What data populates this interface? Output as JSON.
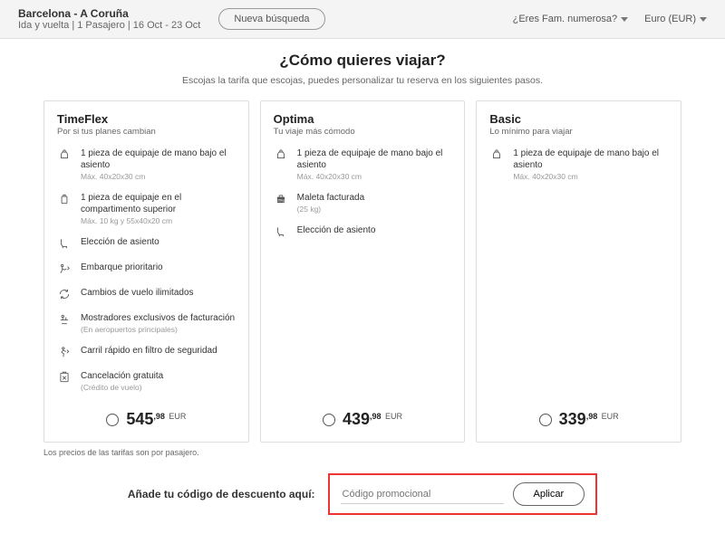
{
  "topbar": {
    "route": "Barcelona - A Coruña",
    "details": "Ida y vuelta | 1 Pasajero | 16 Oct - 23 Oct",
    "new_search": "Nueva búsqueda",
    "fam": "¿Eres Fam. numerosa?",
    "currency": "Euro (EUR)"
  },
  "heading": {
    "title": "¿Cómo quieres viajar?",
    "subtitle": "Escojas la tarifa que escojas, puedes personalizar tu reserva en los siguientes pasos."
  },
  "fares": [
    {
      "name": "TimeFlex",
      "tagline": "Por si tus planes cambian",
      "price_int": "545",
      "price_dec": ",98",
      "currency": "EUR",
      "features": [
        {
          "icon": "bag-under-seat",
          "text": "1 pieza de equipaje de mano bajo el asiento",
          "sub": "Máx. 40x20x30 cm"
        },
        {
          "icon": "cabin-bag",
          "text": "1 pieza de equipaje en el compartimento superior",
          "sub": "Máx. 10 kg y 55x40x20 cm"
        },
        {
          "icon": "seat",
          "text": "Elección de asiento",
          "sub": ""
        },
        {
          "icon": "priority",
          "text": "Embarque prioritario",
          "sub": ""
        },
        {
          "icon": "changes",
          "text": "Cambios de vuelo ilimitados",
          "sub": ""
        },
        {
          "icon": "desk",
          "text": "Mostradores exclusivos de facturación",
          "sub": "(En aeropuertos principales)"
        },
        {
          "icon": "fast-lane",
          "text": "Carril rápido en filtro de seguridad",
          "sub": ""
        },
        {
          "icon": "cancel",
          "text": "Cancelación gratuita",
          "sub": "(Crédito de vuelo)"
        }
      ]
    },
    {
      "name": "Optima",
      "tagline": "Tu viaje más cómodo",
      "price_int": "439",
      "price_dec": ",98",
      "currency": "EUR",
      "features": [
        {
          "icon": "bag-under-seat",
          "text": "1 pieza de equipaje de mano bajo el asiento",
          "sub": "Máx. 40x20x30 cm"
        },
        {
          "icon": "checked-bag",
          "text": "Maleta facturada",
          "sub": "(25 kg)"
        },
        {
          "icon": "seat",
          "text": "Elección de asiento",
          "sub": ""
        }
      ]
    },
    {
      "name": "Basic",
      "tagline": "Lo mínimo para viajar",
      "price_int": "339",
      "price_dec": ",98",
      "currency": "EUR",
      "features": [
        {
          "icon": "bag-under-seat",
          "text": "1 pieza de equipaje de mano bajo el asiento",
          "sub": "Máx. 40x20x30 cm"
        }
      ]
    }
  ],
  "footnote": "Los precios de las tarifas son por pasajero.",
  "promo": {
    "label": "Añade tu código de descuento aquí:",
    "placeholder": "Código promocional",
    "apply": "Aplicar"
  }
}
